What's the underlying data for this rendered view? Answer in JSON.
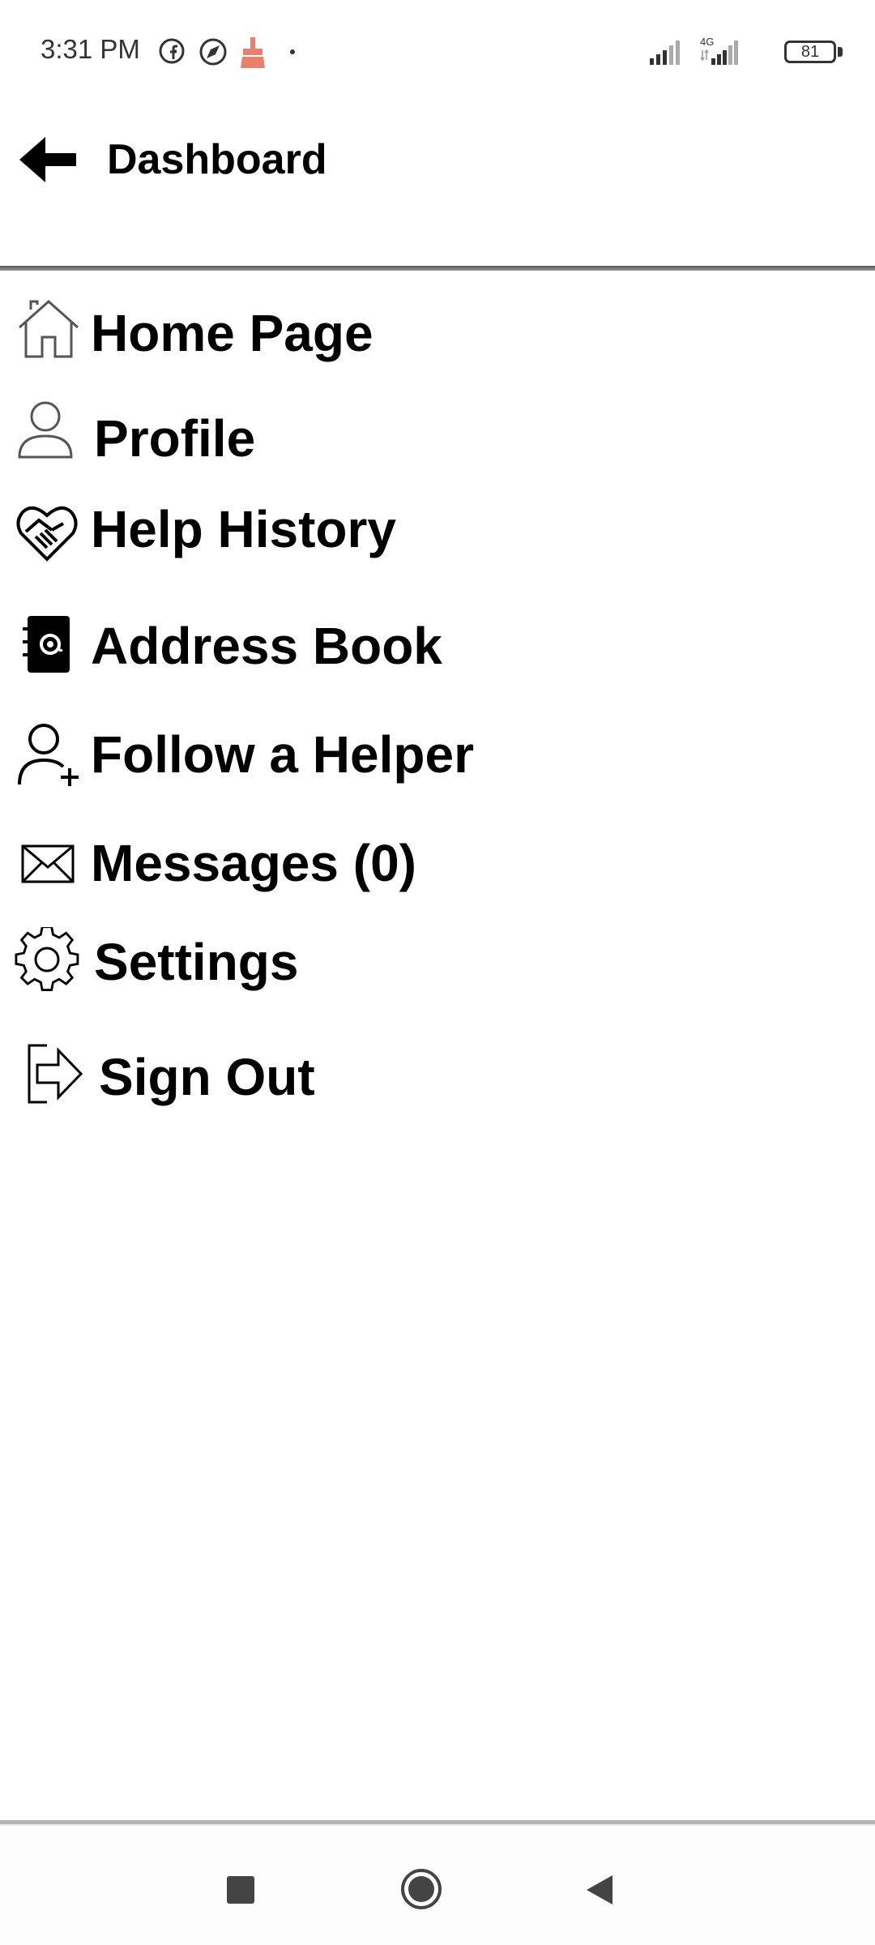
{
  "status_bar": {
    "time": "3:31 PM",
    "battery_level": "81",
    "network_type": "4G",
    "icons": [
      "facebook-icon",
      "browser-icon",
      "cleaner-icon",
      "dot-icon",
      "signal-icon",
      "signal-4g-icon",
      "battery-icon"
    ]
  },
  "header": {
    "title": "Dashboard",
    "back_icon": "arrow-left-icon"
  },
  "menu": {
    "items": [
      {
        "label": "Home Page",
        "icon": "home-icon"
      },
      {
        "label": "Profile",
        "icon": "user-icon"
      },
      {
        "label": "Help History",
        "icon": "handshake-heart-icon"
      },
      {
        "label": "Address Book",
        "icon": "address-book-icon"
      },
      {
        "label": "Follow a Helper",
        "icon": "user-plus-icon"
      },
      {
        "label": "Messages (0)",
        "icon": "envelope-icon"
      },
      {
        "label": "Settings",
        "icon": "gear-icon"
      },
      {
        "label": "Sign Out",
        "icon": "sign-out-icon"
      }
    ]
  },
  "nav_bar": {
    "buttons": [
      "recents-square-icon",
      "home-circle-icon",
      "back-triangle-icon"
    ]
  },
  "colors": {
    "background": "#ffffff",
    "text": "#000000",
    "status_text": "#333333",
    "cleaner_icon": "#e8806e",
    "divider": "#555555"
  }
}
